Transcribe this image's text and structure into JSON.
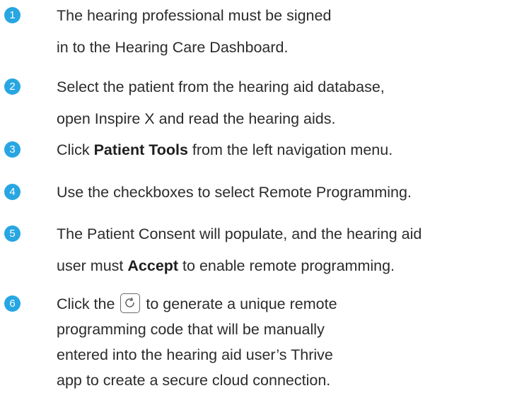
{
  "steps": [
    {
      "number": "1",
      "lines": [
        "The hearing professional must be signed",
        "in to the Hearing Care Dashboard."
      ]
    },
    {
      "number": "2",
      "lines": [
        "Select the patient from the hearing aid database,",
        "open Inspire X and read the hearing aids."
      ]
    },
    {
      "number": "3",
      "pre": "Click ",
      "bold": "Patient Tools",
      "post": " from the left navigation menu."
    },
    {
      "number": "4",
      "lines": [
        "Use the checkboxes to select Remote Programming."
      ]
    },
    {
      "number": "5",
      "line1": "The Patient Consent will populate, and the hearing aid",
      "pre": "user must ",
      "bold": "Accept",
      "post": " to enable remote programming."
    },
    {
      "number": "6",
      "pre": "Click the ",
      "post": " to generate a unique remote",
      "icon": "refresh-icon",
      "lines": [
        "programming code that will be manually",
        "entered into the hearing aid user’s Thrive",
        "app to create a secure cloud connection."
      ]
    }
  ],
  "colors": {
    "badge": "#27a6e2",
    "text": "#2b2b2b"
  }
}
